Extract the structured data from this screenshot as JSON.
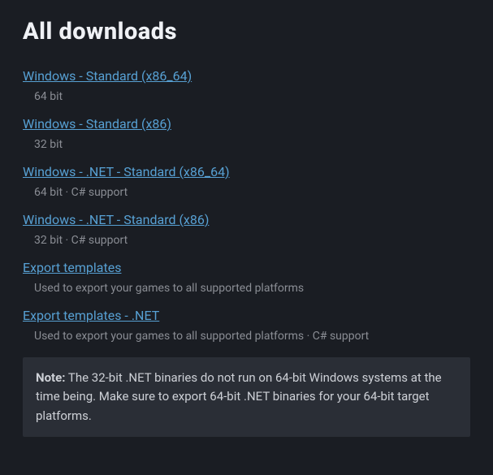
{
  "title": "All downloads",
  "downloads": [
    {
      "name": "Windows - Standard (x86_64)",
      "desc": "64 bit"
    },
    {
      "name": "Windows - Standard (x86)",
      "desc": "32 bit"
    },
    {
      "name": "Windows - .NET - Standard (x86_64)",
      "desc": "64 bit · C# support"
    },
    {
      "name": "Windows - .NET - Standard (x86)",
      "desc": "32 bit · C# support"
    },
    {
      "name": "Export templates",
      "desc": "Used to export your games to all supported platforms"
    },
    {
      "name": "Export templates - .NET",
      "desc": "Used to export your games to all supported platforms · C# support"
    }
  ],
  "note": {
    "label": "Note:",
    "text": " The 32-bit .NET binaries do not run on 64-bit Windows systems at the time being. Make sure to export 64-bit .NET binaries for your 64-bit target platforms."
  }
}
